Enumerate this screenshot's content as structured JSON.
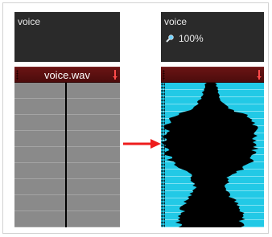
{
  "before": {
    "layer_name": "voice",
    "track_label": "voice.wav"
  },
  "after": {
    "layer_name": "voice",
    "zoom_label": "100%"
  },
  "icons": [
    "arrow-right-icon",
    "magnifier-icon",
    "sound-marker-icon"
  ],
  "colors": {
    "header_bg": "#2a2a2a",
    "track_bar": "#5a1010",
    "cells_gray": "#8a8a8a",
    "cells_cyan": "#22c9e6",
    "waveform": "#000000",
    "arrow": "#ee1c1c"
  }
}
